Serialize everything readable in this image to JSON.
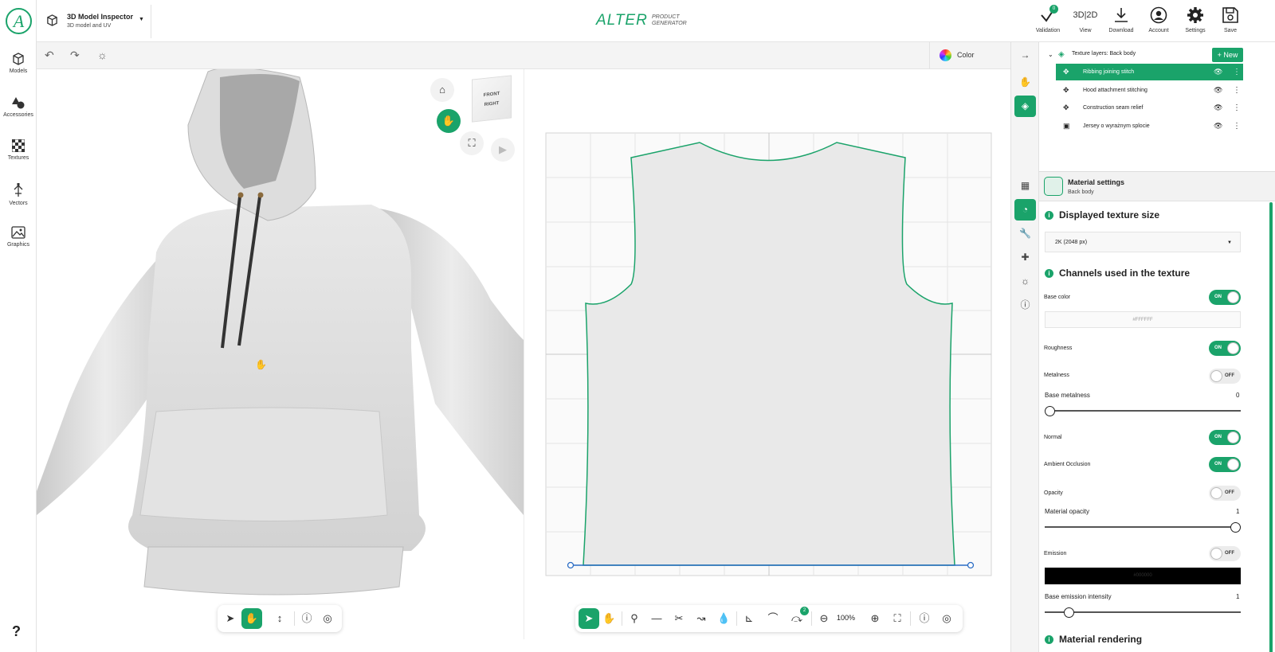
{
  "app": {
    "logo_letter": "A",
    "help": "?"
  },
  "sidebar": {
    "items": [
      {
        "label": "Models",
        "icon": "cube-icon"
      },
      {
        "label": "Accessories",
        "icon": "shapes-icon"
      },
      {
        "label": "Textures",
        "icon": "checker-icon"
      },
      {
        "label": "Vectors",
        "icon": "vector-icon"
      },
      {
        "label": "Graphics",
        "icon": "image-icon"
      }
    ]
  },
  "header": {
    "inspector_title": "3D Model Inspector",
    "inspector_subtitle": "3D model and UV",
    "brand": "ALTER",
    "brand_sub": "PRODUCT GENERATOR",
    "validation_count": "0",
    "buttons": [
      {
        "label": "Validation",
        "icon": "check-icon"
      },
      {
        "label": "View",
        "icon": "3d-2d-icon"
      },
      {
        "label": "Download",
        "icon": "download-icon"
      },
      {
        "label": "Account",
        "icon": "account-icon"
      },
      {
        "label": "Settings",
        "icon": "gear-icon"
      },
      {
        "label": "Save",
        "icon": "save-icon"
      }
    ],
    "view_label_3d": "3D",
    "view_label_2d": "2D"
  },
  "toolbar": {
    "color_mode": "Color"
  },
  "viewer3d": {
    "cube_front": "FRONT",
    "cube_right": "RIGHT"
  },
  "viewer2d": {
    "zoom": "100%",
    "snap_badge": "2"
  },
  "layers": {
    "header": "Texture layers: Back body",
    "new_label": "+ New",
    "items": [
      {
        "label": "Ribbing joining stitch",
        "selected": true
      },
      {
        "label": "Hood attachment stitching",
        "selected": false
      },
      {
        "label": "Construction seam relief",
        "selected": false
      },
      {
        "label": "Jersey o wyrażnym splocie",
        "selected": false
      }
    ]
  },
  "material": {
    "title": "Material settings",
    "subtitle": "Back body",
    "texture_size_title": "Displayed texture size",
    "texture_size_value": "2K (2048 px)",
    "channels_title": "Channels used in the texture",
    "base_color_label": "Base color",
    "base_color_state": "ON",
    "base_color_hex": "#FFFFFF",
    "roughness_label": "Roughness",
    "roughness_state": "ON",
    "metalness_label": "Metalness",
    "metalness_state": "OFF",
    "base_metalness_label": "Base metalness",
    "base_metalness_value": "0",
    "normal_label": "Normal",
    "normal_state": "ON",
    "ao_label": "Ambient Occlusion",
    "ao_state": "ON",
    "opacity_label": "Opacity",
    "opacity_state": "OFF",
    "material_opacity_label": "Material opacity",
    "material_opacity_value": "1",
    "emission_label": "Emission",
    "emission_state": "OFF",
    "emission_hex": "#000000",
    "emission_intensity_label": "Base emission intensity",
    "emission_intensity_value": "1",
    "rendering_title": "Material rendering"
  },
  "colors": {
    "accent": "#1aa36a",
    "uv_outline": "#1aa36a",
    "uv_baseline": "#2a6cc4"
  }
}
